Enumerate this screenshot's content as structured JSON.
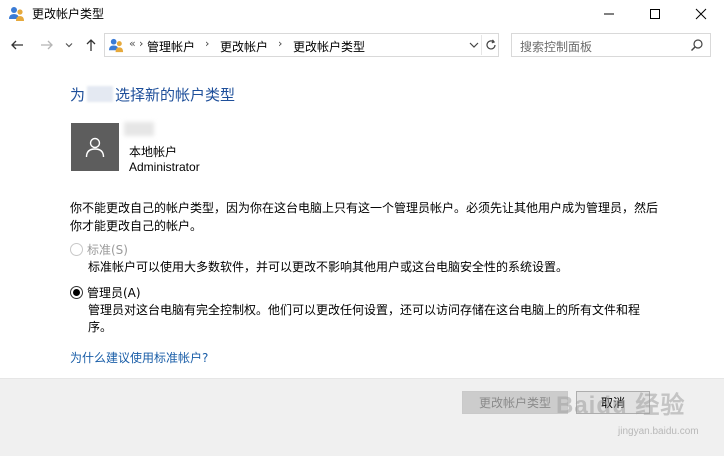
{
  "window": {
    "title": "更改帐户类型",
    "icon": "users-icon"
  },
  "nav": {
    "overflow": "«",
    "breadcrumbs": [
      "管理帐户",
      "更改帐户",
      "更改帐户类型"
    ],
    "search_placeholder": "搜索控制面板"
  },
  "main": {
    "heading_prefix": "为",
    "heading_suffix": "选择新的帐户类型",
    "account": {
      "type": "本地帐户",
      "name": "Administrator"
    },
    "notice": "你不能更改自己的帐户类型，因为你在这台电脑上只有这一个管理员帐户。必须先让其他用户成为管理员，然后你才能更改自己的帐户。",
    "options": [
      {
        "label": "标准(S)",
        "description": "标准帐户可以使用大多数软件，并可以更改不影响其他用户或这台电脑安全性的系统设置。",
        "selected": false,
        "enabled": false
      },
      {
        "label": "管理员(A)",
        "description": "管理员对这台电脑有完全控制权。他们可以更改任何设置，还可以访问存储在这台电脑上的所有文件和程序。",
        "selected": true,
        "enabled": true
      }
    ],
    "why_link": "为什么建议使用标准帐户?"
  },
  "footer": {
    "change_label": "更改帐户类型",
    "cancel_label": "取消"
  },
  "watermark": {
    "main": "Baidu 经验",
    "sub": "jingyan.baidu.com"
  },
  "colors": {
    "heading": "#1e4f9a",
    "link": "#1a5ea8",
    "avatar_bg": "#5d5d5d",
    "footer_bg": "#f0f0f0"
  }
}
